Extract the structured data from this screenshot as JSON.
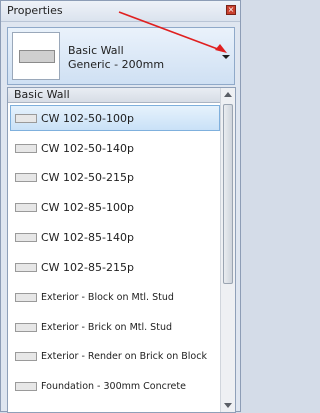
{
  "panel": {
    "title": "Properties"
  },
  "type_selector": {
    "family": "Basic Wall",
    "type": "Generic - 200mm"
  },
  "list": {
    "group_header": "Basic Wall",
    "items": [
      {
        "label": "CW 102-50-100p",
        "selected": true,
        "icon": "wall-swatch-icon"
      },
      {
        "label": "CW 102-50-140p",
        "icon": "wall-swatch-icon"
      },
      {
        "label": "CW 102-50-215p",
        "icon": "wall-swatch-icon"
      },
      {
        "label": "CW 102-85-100p",
        "icon": "wall-swatch-icon"
      },
      {
        "label": "CW 102-85-140p",
        "icon": "wall-swatch-icon"
      },
      {
        "label": "CW 102-85-215p",
        "icon": "wall-swatch-icon"
      },
      {
        "label": "Exterior - Block on Mtl. Stud",
        "icon": "wall-swatch-icon"
      },
      {
        "label": "Exterior - Brick on Mtl. Stud",
        "icon": "wall-swatch-icon"
      },
      {
        "label": "Exterior - Render on Brick on Block",
        "icon": "wall-swatch-icon"
      },
      {
        "label": "Foundation - 300mm Concrete",
        "icon": "wall-swatch-icon"
      }
    ]
  },
  "annotation": {
    "color": "#e02020"
  }
}
